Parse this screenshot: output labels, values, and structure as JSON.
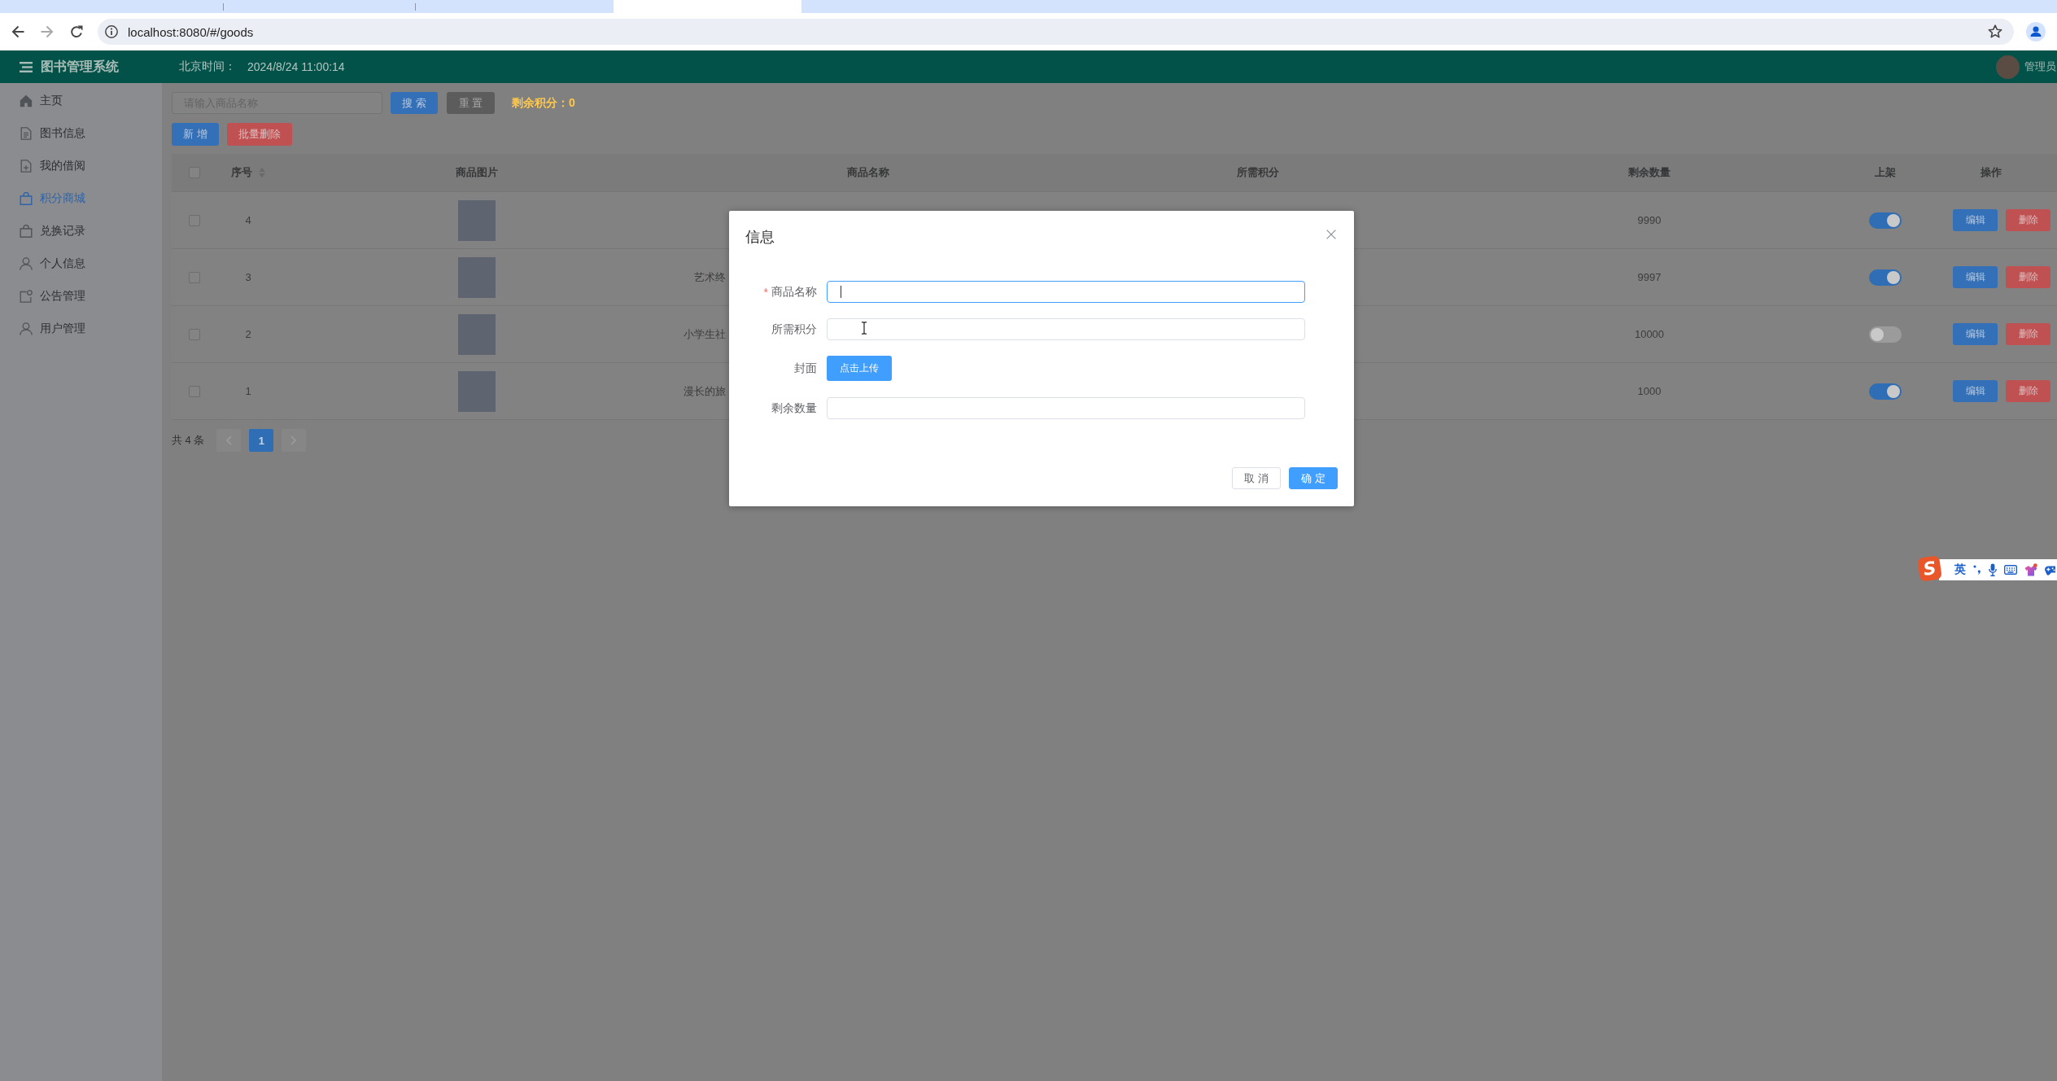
{
  "browser": {
    "url": "localhost:8080/#/goods"
  },
  "header": {
    "title": "图书管理系统",
    "clock_label": "北京时间：",
    "clock": "2024/8/24 11:00:14",
    "user": "管理员"
  },
  "sidebar": {
    "items": [
      {
        "kind": "home",
        "label": "主页",
        "selected": false
      },
      {
        "kind": "doc",
        "label": "图书信息",
        "selected": false
      },
      {
        "kind": "docadd",
        "label": "我的借阅",
        "selected": false
      },
      {
        "kind": "bag",
        "label": "积分商城",
        "selected": true
      },
      {
        "kind": "bag",
        "label": "兑换记录",
        "selected": false
      },
      {
        "kind": "user",
        "label": "个人信息",
        "selected": false
      },
      {
        "kind": "notice",
        "label": "公告管理",
        "selected": false
      },
      {
        "kind": "user",
        "label": "用户管理",
        "selected": false
      }
    ]
  },
  "toolbar": {
    "search": {
      "placeholder": "请输入商品名称"
    },
    "search_button": "搜 索",
    "reset_button": "重 置",
    "points": "剩余积分：0",
    "add_button": "新 增",
    "batch_delete_button": "批量删除"
  },
  "table": {
    "select_all": {
      "checked": false
    },
    "columns": [
      {
        "label": "序号",
        "sortable": true
      },
      {
        "label": "商品图片",
        "sortable": false
      },
      {
        "label": "商品名称",
        "sortable": false
      },
      {
        "label": "所需积分",
        "sortable": false
      },
      {
        "label": "剩余数量",
        "sortable": false
      },
      {
        "label": "上架",
        "sortable": false
      },
      {
        "label": "操作",
        "sortable": false
      }
    ],
    "rows": [
      {
        "checked": false,
        "number": "4",
        "stock": "9990",
        "on_shelf": true,
        "actions": [
          {
            "kind": "edit",
            "label": "编辑"
          },
          {
            "kind": "delete",
            "label": "删除"
          }
        ]
      },
      {
        "checked": false,
        "number": "3",
        "name": "艺术终",
        "stock": "9997",
        "on_shelf": true,
        "actions": [
          {
            "kind": "edit",
            "label": "编辑"
          },
          {
            "kind": "delete",
            "label": "删除"
          }
        ]
      },
      {
        "checked": false,
        "number": "2",
        "name": "小学生社",
        "stock": "10000",
        "on_shelf": false,
        "actions": [
          {
            "kind": "edit",
            "label": "编辑"
          },
          {
            "kind": "delete",
            "label": "删除"
          }
        ]
      },
      {
        "checked": false,
        "number": "1",
        "name": "漫长的旅",
        "stock": "1000",
        "on_shelf": true,
        "actions": [
          {
            "kind": "edit",
            "label": "编辑"
          },
          {
            "kind": "delete",
            "label": "删除"
          }
        ]
      }
    ]
  },
  "pagination": {
    "total": "共 4 条",
    "prev_disabled": true,
    "pages": [
      {
        "label": "1",
        "selected": true
      }
    ],
    "next_disabled": true
  },
  "dialog": {
    "title": "信息",
    "fields": [
      {
        "kind": "input",
        "label": "商品名称",
        "required_mark": "*",
        "focused": true
      },
      {
        "kind": "input",
        "label": "所需积分",
        "focused": false
      },
      {
        "kind": "upload",
        "label": "封面",
        "button": "点击上传"
      },
      {
        "kind": "input",
        "label": "剩余数量",
        "focused": false
      }
    ],
    "buttons": [
      {
        "label": "取 消",
        "primary": false
      },
      {
        "label": "确 定",
        "primary": true
      }
    ]
  },
  "ime": {
    "logo": "S",
    "mode": "英"
  }
}
